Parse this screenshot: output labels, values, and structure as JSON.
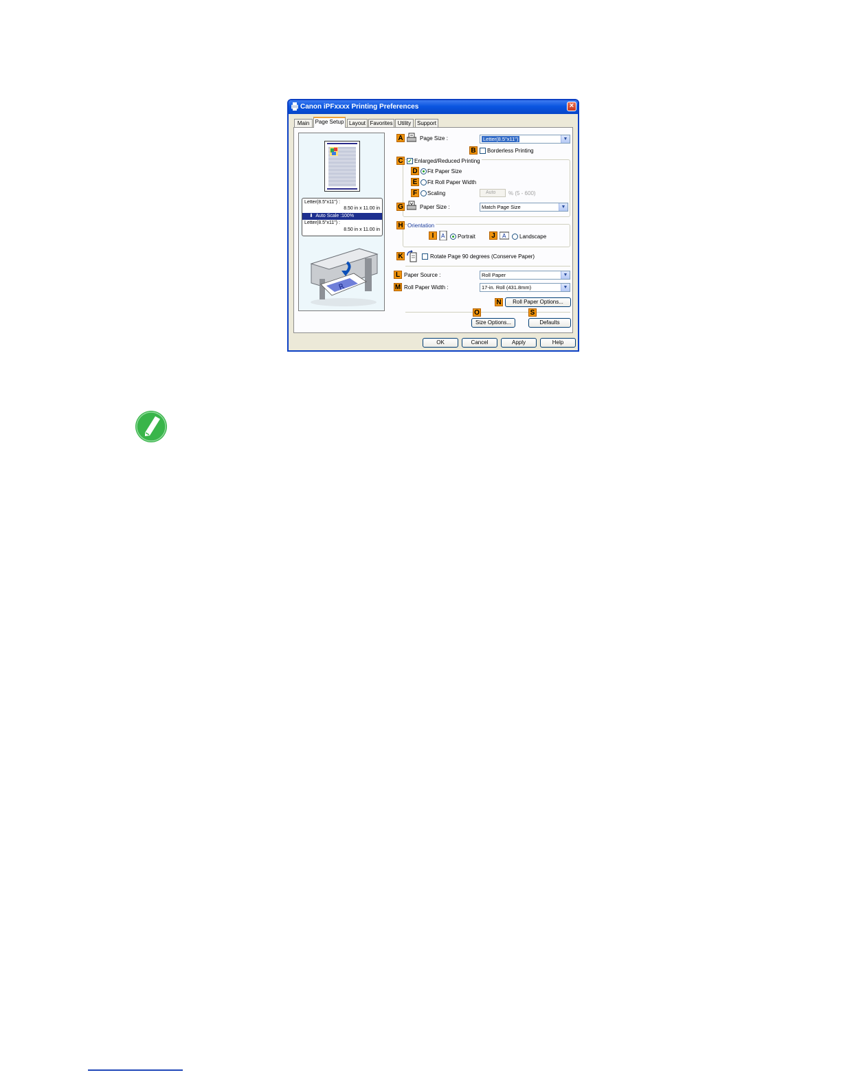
{
  "window": {
    "title": "Canon iPFxxxx Printing Preferences",
    "close_glyph": "×"
  },
  "tabs": [
    {
      "label": "Main"
    },
    {
      "label": "Page Setup"
    },
    {
      "label": "Layout"
    },
    {
      "label": "Favorites"
    },
    {
      "label": "Utility"
    },
    {
      "label": "Support"
    }
  ],
  "preview": {
    "info_line1": "Letter(8.5\"x11\") :",
    "info_line2": "8.50 in x 11.00 in",
    "scale_line": "Auto Scale :100%",
    "info_line3": "Letter(8.5\"x11\") :",
    "info_line4": "8.50 in x 11.00 in"
  },
  "badges": {
    "A": "A",
    "B": "B",
    "C": "C",
    "D": "D",
    "E": "E",
    "F": "F",
    "G": "G",
    "H": "H",
    "I": "I",
    "J": "J",
    "K": "K",
    "L": "L",
    "M": "M",
    "N": "N",
    "O": "O",
    "S": "S"
  },
  "form": {
    "page_size_label": "Page Size :",
    "page_size_value": "Letter(8.5\"x11\")",
    "borderless_label": "Borderless Printing",
    "enlarged_label": "Enlarged/Reduced Printing",
    "fit_paper_size_label": "Fit Paper Size",
    "fit_roll_width_label": "Fit Roll Paper Width",
    "scaling_label": "Scaling",
    "scaling_value": "Auto",
    "scaling_range": "% (5 - 600)",
    "paper_size_label": "Paper Size :",
    "paper_size_value": "Match Page Size",
    "orientation_label": "Orientation",
    "portrait_label": "Portrait",
    "landscape_label": "Landscape",
    "rotate_label": "Rotate Page 90 degrees (Conserve Paper)",
    "paper_source_label": "Paper Source :",
    "paper_source_value": "Roll Paper",
    "roll_width_label": "Roll Paper Width :",
    "roll_width_value": "17-in. Roll (431.8mm)",
    "roll_options_button": "Roll Paper Options...",
    "size_options_button": "Size Options...",
    "defaults_button": "Defaults"
  },
  "footer": {
    "ok": "OK",
    "cancel": "Cancel",
    "apply": "Apply",
    "help": "Help"
  },
  "dropdown_arrow": "▼",
  "check_mark": "✓",
  "colors": {
    "title_bar": "#0a55e0",
    "badge": "#f0940d",
    "note_icon": "#39b54a"
  }
}
